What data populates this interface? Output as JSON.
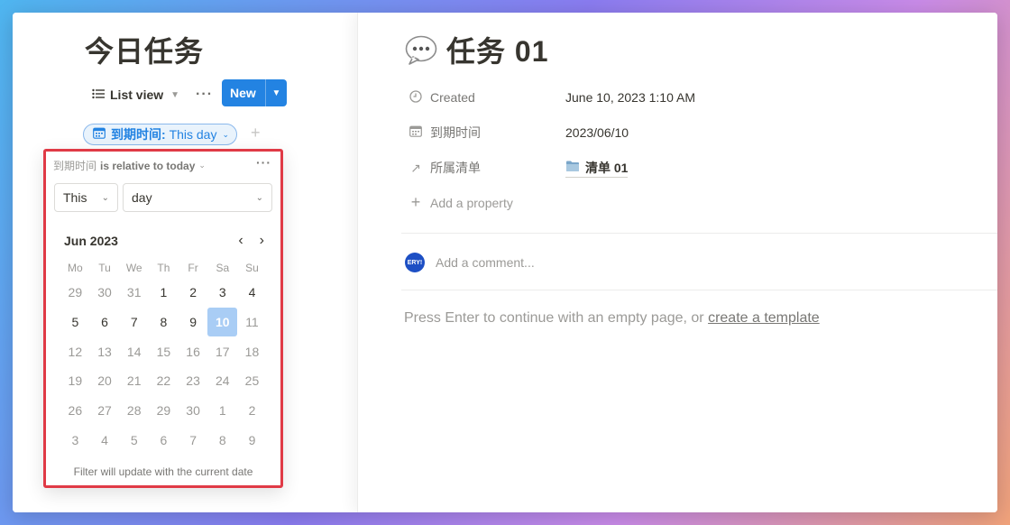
{
  "database": {
    "title": "今日任务",
    "view": {
      "label": "List view",
      "icon": "list-icon"
    },
    "more_icon": "more-dots-icon",
    "new_button": {
      "label": "New"
    },
    "filter": {
      "property": "到期时间",
      "condition": "This day",
      "separator": ": ",
      "icon": "calendar-icon"
    }
  },
  "filter_popup": {
    "property": "到期时间",
    "relation_label": "is relative to today",
    "this_select": "This",
    "unit_select": "day",
    "month_label": "Jun 2023",
    "weekdays": [
      "Mo",
      "Tu",
      "We",
      "Th",
      "Fr",
      "Sa",
      "Su"
    ],
    "weeks": [
      [
        "29",
        "30",
        "31",
        "1",
        "2",
        "3",
        "4"
      ],
      [
        "5",
        "6",
        "7",
        "8",
        "9",
        "10",
        "11"
      ],
      [
        "12",
        "13",
        "14",
        "15",
        "16",
        "17",
        "18"
      ],
      [
        "19",
        "20",
        "21",
        "22",
        "23",
        "24",
        "25"
      ],
      [
        "26",
        "27",
        "28",
        "29",
        "30",
        "1",
        "2"
      ],
      [
        "3",
        "4",
        "5",
        "6",
        "7",
        "8",
        "9"
      ]
    ],
    "selected_day": "10",
    "footer": "Filter will update with the current date"
  },
  "page": {
    "icon": "speech-bubble-icon",
    "title": "任务 01",
    "properties": [
      {
        "icon": "clock-icon",
        "name": "Created",
        "value": "June 10, 2023 1:10 AM"
      },
      {
        "icon": "calendar-icon",
        "name": "到期时间",
        "value": "2023/06/10"
      },
      {
        "icon": "arrow-up-right-icon",
        "name": "所属清单",
        "value": "清单 01",
        "value_icon": "folder-icon"
      }
    ],
    "add_property": "Add a property",
    "comment": {
      "avatar_text": "ERY!",
      "placeholder": "Add a comment..."
    },
    "empty_hint": "Press Enter to continue with an empty page, or ",
    "template_link": "create a template"
  }
}
